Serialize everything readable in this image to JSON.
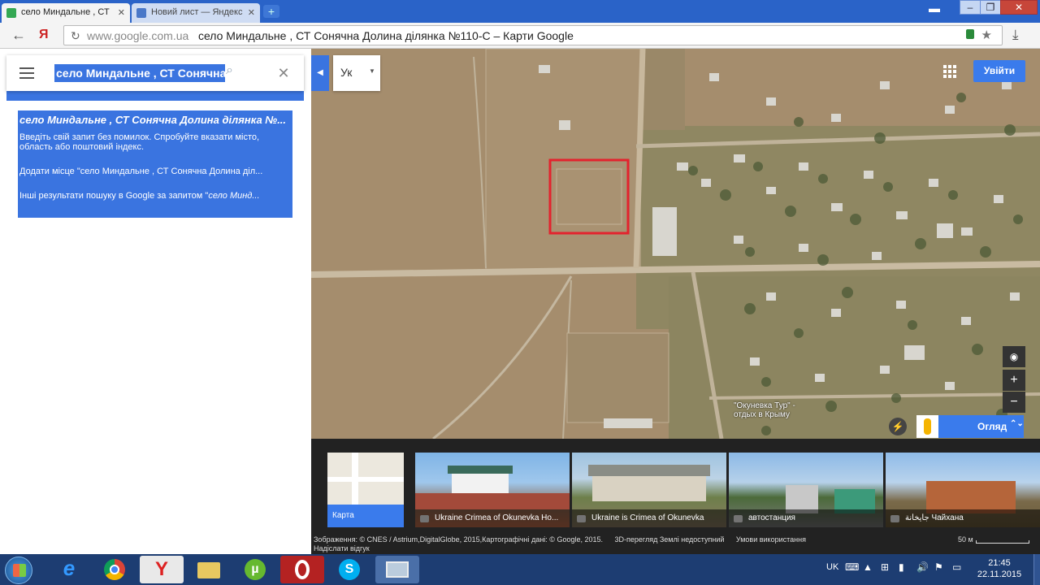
{
  "browser": {
    "tabs": [
      {
        "label": "село Миндальне , СТ",
        "active": true
      },
      {
        "label": "Новий лист — Яндекс",
        "active": false
      }
    ],
    "address": {
      "domain": "www.google.com.ua",
      "title": "село Миндальне , СТ Сонячна Долина ділянка №110-С – Карти Google"
    }
  },
  "search": {
    "query": "село Миндальне , СТ Сонячна Д",
    "results": {
      "title": "село Миндальне , СТ Сонячна Долина ділянка №...",
      "hint_line1": "Введіть свій запит без помилок. Спробуйте вказати місто,",
      "hint_line2": "область або поштовий індекс.",
      "add_place": "Додати місце \"село Миндальне , СТ Сонячна Долина діл...",
      "other_results_prefix": "Інші результати пошуку в Google за запитом \"",
      "other_results_query": "село Минд..."
    }
  },
  "map": {
    "language": "Ук",
    "login": "Увійти",
    "place_label_line1": "\"Окуневка Тур\" -",
    "place_label_line2": "отдых в Крыму",
    "view_button": "Огляд",
    "zoom_in": "+",
    "zoom_out": "−"
  },
  "strip": {
    "map_card": "Карта",
    "photos": [
      "Ukraine Crimea of Okunevka Ho...",
      "Ukraine is Crimea of Okunevka",
      "автостанция",
      "جايخانة Чайхана"
    ],
    "credits_line1": "Зображення: © CNES / Astrium,DigitalGlobe, 2015,Картографічні дані: © Google, 2015.",
    "credits_3d": "3D-перегляд Землі недоступний",
    "credits_terms": "Умови використання",
    "credits_feedback": "Надіслати відгук",
    "scale": "50 м"
  },
  "taskbar": {
    "lang": "UK",
    "time": "21:45",
    "date": "22.11.2015"
  }
}
